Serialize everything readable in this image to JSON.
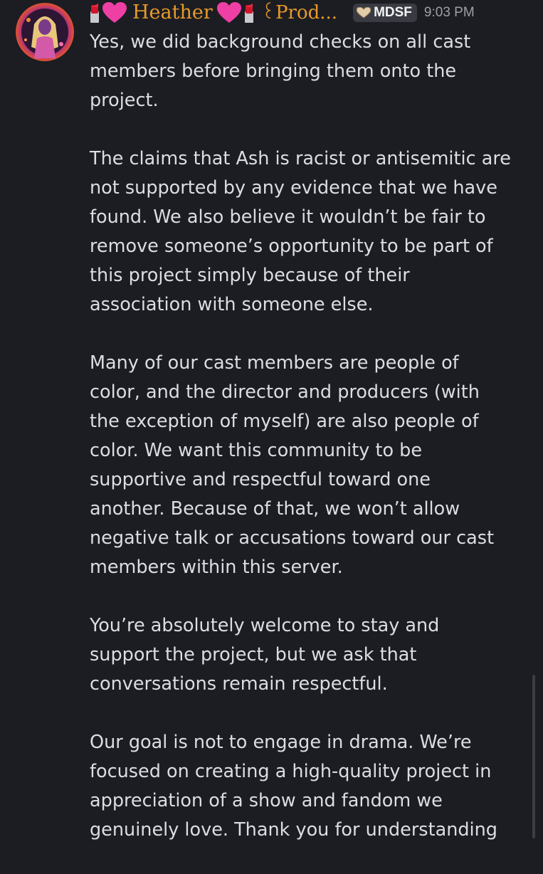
{
  "message": {
    "author": {
      "name": "Heather",
      "suffix": "꒰Prod...",
      "emoji_lipstick": "lipstick-icon",
      "emoji_heart": "heart-icon",
      "avatar": "avatar"
    },
    "tag": {
      "icon": "heart-badge-icon",
      "label": "MDSF"
    },
    "timestamp": "9:03 PM",
    "paragraphs": [
      {
        "lines": [
          "Yes, we did background checks on all cast",
          "members before bringing them onto the",
          "project."
        ]
      },
      {
        "lines": [
          "The claims that Ash is racist or antisemitic are",
          "not supported by any evidence that we have",
          "found. We also believe it wouldn’t be fair to",
          "remove someone’s opportunity to be part of",
          "this project simply because of their",
          "association with someone else."
        ]
      },
      {
        "lines": [
          "Many of our cast members are people of",
          "color, and the director and producers (with",
          "the exception of myself) are also people of",
          "color. We want this community to be",
          "supportive and respectful toward one",
          "another. Because of that, we won’t allow",
          "negative talk or accusations toward our cast",
          "members within this server."
        ]
      },
      {
        "lines": [
          "You’re absolutely welcome to stay and",
          "support the project, but we ask that",
          "conversations remain respectful."
        ]
      },
      {
        "lines": [
          "Our goal is not to engage in drama. We’re",
          "focused on creating a high-quality project in",
          "appreciation of a show and fandom we",
          "genuinely love. Thank you for understanding"
        ]
      }
    ]
  },
  "colors": {
    "background": "#1c1d23",
    "username": "#e89a2a",
    "text": "#dbdee1",
    "timestamp": "#9da0a8",
    "tag_background": "#3a3b42"
  }
}
